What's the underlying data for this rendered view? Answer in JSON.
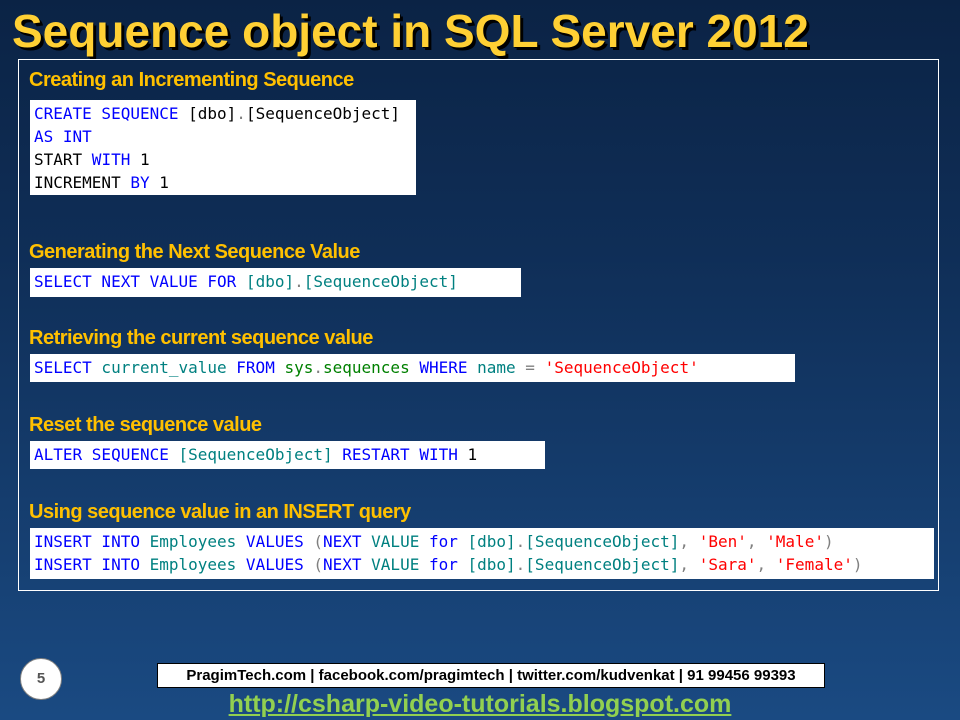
{
  "title": "Sequence object in SQL Server 2012",
  "colors": {
    "title": "#ffd034",
    "heading": "#ffc000",
    "keyword": "#0000ff",
    "function": "#008080",
    "system": "#008000",
    "string": "#ff0000",
    "operator": "#808080",
    "link": "#92d050"
  },
  "sections": [
    {
      "heading": "Creating an Incrementing Sequence",
      "code": [
        [
          {
            "t": "CREATE SEQUENCE",
            "c": "kw"
          },
          {
            "t": " [dbo]",
            "c": "id"
          },
          {
            "t": ".",
            "c": "op"
          },
          {
            "t": "[SequenceObject]",
            "c": "id"
          }
        ],
        [
          {
            "t": "AS INT",
            "c": "kw"
          }
        ],
        [
          {
            "t": "START",
            "c": "id"
          },
          {
            "t": " WITH",
            "c": "kw"
          },
          {
            "t": " 1",
            "c": "id"
          }
        ],
        [
          {
            "t": "INCREMENT",
            "c": "id"
          },
          {
            "t": " BY",
            "c": "kw"
          },
          {
            "t": " 1",
            "c": "id"
          }
        ]
      ]
    },
    {
      "heading": "Generating the Next Sequence Value",
      "code": [
        [
          {
            "t": "SELECT NEXT VALUE FOR",
            "c": "kw"
          },
          {
            "t": " [dbo]",
            "c": "fn"
          },
          {
            "t": ".",
            "c": "op"
          },
          {
            "t": "[SequenceObject]",
            "c": "fn"
          }
        ]
      ]
    },
    {
      "heading": "Retrieving the current sequence value",
      "code": [
        [
          {
            "t": "SELECT",
            "c": "kw"
          },
          {
            "t": " current_value",
            "c": "fn"
          },
          {
            "t": " FROM",
            "c": "kw"
          },
          {
            "t": " sys",
            "c": "sy"
          },
          {
            "t": ".",
            "c": "op"
          },
          {
            "t": "sequences",
            "c": "sy"
          },
          {
            "t": " WHERE",
            "c": "kw"
          },
          {
            "t": " name",
            "c": "fn"
          },
          {
            "t": " =",
            "c": "op"
          },
          {
            "t": " ",
            "c": "id"
          },
          {
            "t": "'SequenceObject'",
            "c": "st"
          }
        ]
      ]
    },
    {
      "heading": "Reset the sequence value",
      "code": [
        [
          {
            "t": "ALTER SEQUENCE",
            "c": "kw"
          },
          {
            "t": " [SequenceObject]",
            "c": "fn"
          },
          {
            "t": " RESTART WITH",
            "c": "kw"
          },
          {
            "t": " 1",
            "c": "id"
          }
        ]
      ]
    },
    {
      "heading": "Using sequence value in an INSERT query",
      "code": [
        [
          {
            "t": "INSERT INTO",
            "c": "kw"
          },
          {
            "t": " Employees",
            "c": "fn"
          },
          {
            "t": " VALUES",
            "c": "kw"
          },
          {
            "t": " (",
            "c": "op"
          },
          {
            "t": "NEXT",
            "c": "kw"
          },
          {
            "t": " VALUE",
            "c": "fn"
          },
          {
            "t": " for",
            "c": "kw"
          },
          {
            "t": " [dbo]",
            "c": "fn"
          },
          {
            "t": ".",
            "c": "op"
          },
          {
            "t": "[SequenceObject]",
            "c": "fn"
          },
          {
            "t": ",",
            "c": "op"
          },
          {
            "t": " ",
            "c": "id"
          },
          {
            "t": "'Ben'",
            "c": "st"
          },
          {
            "t": ",",
            "c": "op"
          },
          {
            "t": " ",
            "c": "id"
          },
          {
            "t": "'Male'",
            "c": "st"
          },
          {
            "t": ")",
            "c": "op"
          }
        ],
        [
          {
            "t": "INSERT INTO",
            "c": "kw"
          },
          {
            "t": " Employees",
            "c": "fn"
          },
          {
            "t": " VALUES",
            "c": "kw"
          },
          {
            "t": " (",
            "c": "op"
          },
          {
            "t": "NEXT",
            "c": "kw"
          },
          {
            "t": " VALUE",
            "c": "fn"
          },
          {
            "t": " for",
            "c": "kw"
          },
          {
            "t": " [dbo]",
            "c": "fn"
          },
          {
            "t": ".",
            "c": "op"
          },
          {
            "t": "[SequenceObject]",
            "c": "fn"
          },
          {
            "t": ",",
            "c": "op"
          },
          {
            "t": " ",
            "c": "id"
          },
          {
            "t": "'Sara'",
            "c": "st"
          },
          {
            "t": ",",
            "c": "op"
          },
          {
            "t": " ",
            "c": "id"
          },
          {
            "t": "'Female'",
            "c": "st"
          },
          {
            "t": ")",
            "c": "op"
          }
        ]
      ]
    }
  ],
  "footer": {
    "contacts": "PragimTech.com | facebook.com/pragimtech  | twitter.com/kudvenkat  | 91 99456 99393",
    "page_number": "5",
    "link": "http://csharp-video-tutorials.blogspot.com"
  }
}
